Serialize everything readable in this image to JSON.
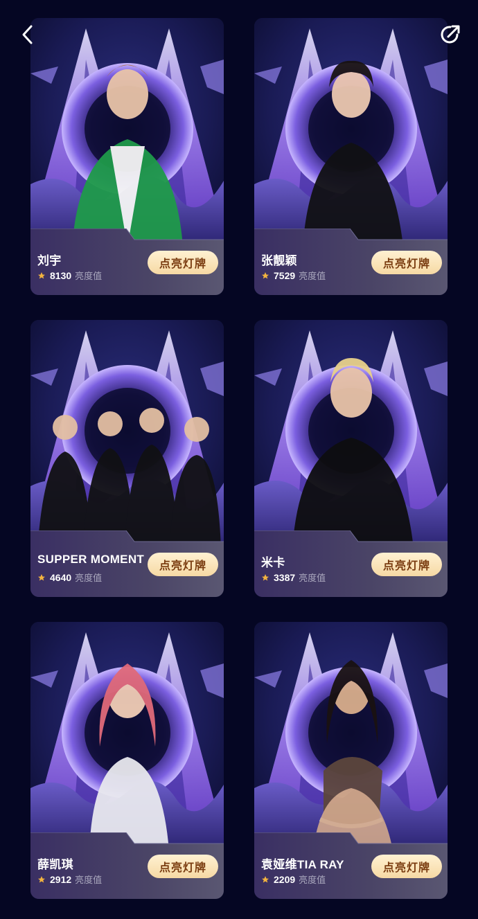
{
  "nav": {
    "back_icon": "chevron-left-icon",
    "share_icon": "share-icon"
  },
  "colors": {
    "background": "#050623",
    "button_gradient": [
      "#fff1d2",
      "#f6d9a4"
    ],
    "button_text": "#7a3c10",
    "star": "#f3b43f"
  },
  "cards": [
    {
      "name": "刘宇",
      "score": "8130",
      "score_label": "亮度值",
      "button": "点亮灯牌"
    },
    {
      "name": "张靓颖",
      "score": "7529",
      "score_label": "亮度值",
      "button": "点亮灯牌"
    },
    {
      "name": "SUPPER MOMENT",
      "score": "4640",
      "score_label": "亮度值",
      "button": "点亮灯牌"
    },
    {
      "name": "米卡",
      "score": "3387",
      "score_label": "亮度值",
      "button": "点亮灯牌"
    },
    {
      "name": "薛凯琪",
      "score": "2912",
      "score_label": "亮度值",
      "button": "点亮灯牌"
    },
    {
      "name": "袁娅维TIA RAY",
      "score": "2209",
      "score_label": "亮度值",
      "button": "点亮灯牌"
    }
  ]
}
